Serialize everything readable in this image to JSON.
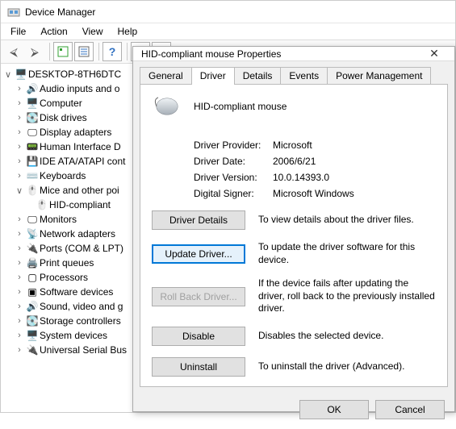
{
  "window": {
    "title": "Device Manager"
  },
  "menu": {
    "file": "File",
    "action": "Action",
    "view": "View",
    "help": "Help"
  },
  "tree": {
    "root": "DESKTOP-8TH6DTC",
    "items": [
      "Audio inputs and o",
      "Computer",
      "Disk drives",
      "Display adapters",
      "Human Interface D",
      "IDE ATA/ATAPI cont",
      "Keyboards",
      "Mice and other poi",
      "Monitors",
      "Network adapters",
      "Ports (COM & LPT)",
      "Print queues",
      "Processors",
      "Software devices",
      "Sound, video and g",
      "Storage controllers",
      "System devices",
      "Universal Serial Bus"
    ],
    "mouse_child": "HID-compliant "
  },
  "dialog": {
    "title": "HID-compliant mouse Properties",
    "tabs": {
      "general": "General",
      "driver": "Driver",
      "details": "Details",
      "events": "Events",
      "power": "Power Management"
    },
    "device_name": "HID-compliant mouse",
    "info": {
      "provider_lbl": "Driver Provider:",
      "provider_val": "Microsoft",
      "date_lbl": "Driver Date:",
      "date_val": "2006/6/21",
      "version_lbl": "Driver Version:",
      "version_val": "10.0.14393.0",
      "signer_lbl": "Digital Signer:",
      "signer_val": "Microsoft Windows"
    },
    "buttons": {
      "details": "Driver Details",
      "update": "Update Driver...",
      "rollback": "Roll Back Driver...",
      "disable": "Disable",
      "uninstall": "Uninstall",
      "ok": "OK",
      "cancel": "Cancel"
    },
    "descriptions": {
      "details": "To view details about the driver files.",
      "update": "To update the driver software for this device.",
      "rollback": "If the device fails after updating the driver, roll back to the previously installed driver.",
      "disable": "Disables the selected device.",
      "uninstall": "To uninstall the driver (Advanced)."
    }
  }
}
